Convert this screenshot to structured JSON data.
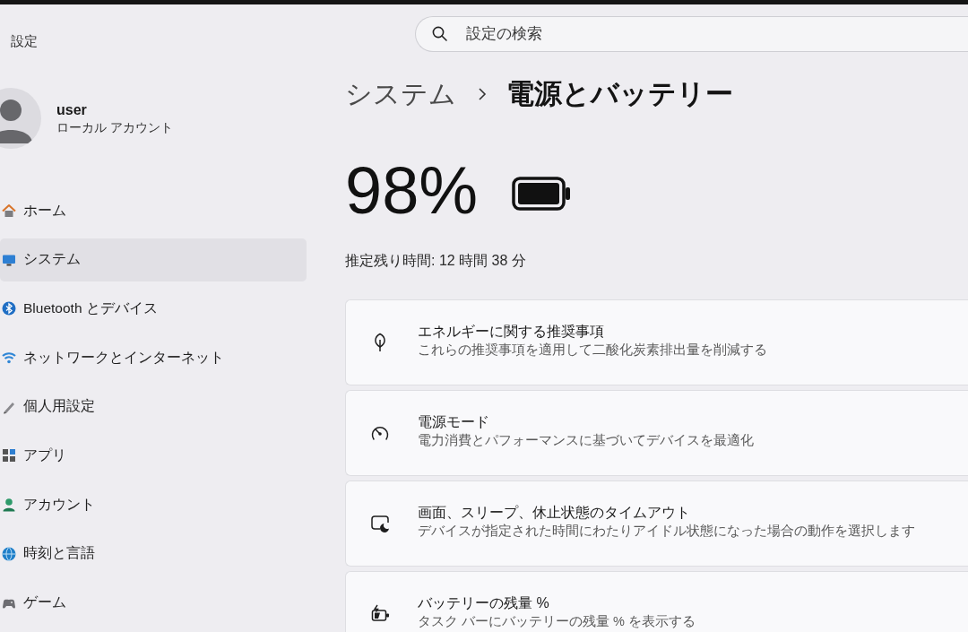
{
  "window": {
    "title": "設定"
  },
  "account": {
    "name": "user",
    "type": "ローカル アカウント"
  },
  "nav": [
    {
      "label": "ホーム",
      "selected": false
    },
    {
      "label": "システム",
      "selected": true
    },
    {
      "label": "Bluetooth とデバイス",
      "selected": false
    },
    {
      "label": "ネットワークとインターネット",
      "selected": false
    },
    {
      "label": "個人用設定",
      "selected": false
    },
    {
      "label": "アプリ",
      "selected": false
    },
    {
      "label": "アカウント",
      "selected": false
    },
    {
      "label": "時刻と言語",
      "selected": false
    },
    {
      "label": "ゲーム",
      "selected": false
    }
  ],
  "search": {
    "placeholder": "設定の検索"
  },
  "breadcrumb": {
    "parent": "システム",
    "current": "電源とバッテリー"
  },
  "battery": {
    "percent": "98%",
    "estimate": "推定残り時間: 12 時間 38 分"
  },
  "cards": [
    {
      "title": "エネルギーに関する推奨事項",
      "description": "これらの推奨事項を適用して二酸化炭素排出量を削減する"
    },
    {
      "title": "電源モード",
      "description": "電力消費とパフォーマンスに基づいてデバイスを最適化"
    },
    {
      "title": "画面、スリープ、休止状態のタイムアウト",
      "description": "デバイスが指定された時間にわたりアイドル状態になった場合の動作を選択します"
    },
    {
      "title": "バッテリーの残量 %",
      "description": "タスク バーにバッテリーの残量 % を表示する"
    }
  ]
}
